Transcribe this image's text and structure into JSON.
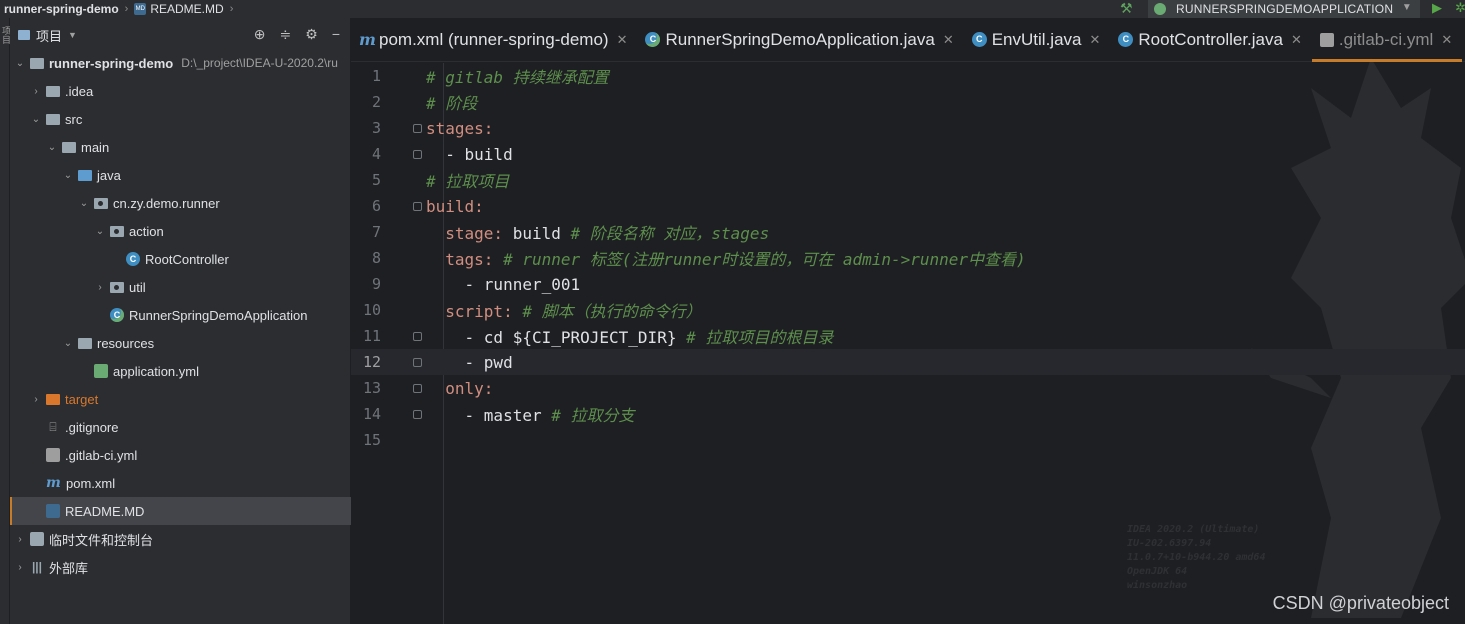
{
  "topbar": {
    "project": "runner-spring-demo",
    "file": "README.MD",
    "run_config": "RUNNERSPRINGDEMOAPPLICATION"
  },
  "toolstrip": {
    "label": "项目"
  },
  "project_panel": {
    "title": "项目",
    "root_name": "runner-spring-demo",
    "root_path": "D:\\_project\\IDEA-U-2020.2\\ru",
    "items": {
      "idea": ".idea",
      "src": "src",
      "main": "main",
      "java": "java",
      "pkg": "cn.zy.demo.runner",
      "action": "action",
      "rootcontroller": "RootController",
      "util": "util",
      "app": "RunnerSpringDemoApplication",
      "resources": "resources",
      "appyml": "application.yml",
      "target": "target",
      "gitignore": ".gitignore",
      "gitlabci": ".gitlab-ci.yml",
      "pom": "pom.xml",
      "readme": "README.MD",
      "scratches": "临时文件和控制台",
      "libraries": "外部库"
    }
  },
  "tabs": [
    {
      "label": "pom.xml (runner-spring-demo)",
      "icon": "maven-icon"
    },
    {
      "label": "RunnerSpringDemoApplication.java",
      "icon": "spring-class-icon"
    },
    {
      "label": "EnvUtil.java",
      "icon": "class-icon"
    },
    {
      "label": "RootController.java",
      "icon": "class-icon"
    },
    {
      "label": ".gitlab-ci.yml",
      "icon": "yaml-icon",
      "active": true
    }
  ],
  "code": {
    "l1": "# gitlab 持续继承配置",
    "l2": "# 阶段",
    "l3": "stages:",
    "l4": "  - build",
    "l5": "# 拉取项目",
    "l6": "build:",
    "l7a": "  stage:",
    "l7b": " build ",
    "l7c": "# 阶段名称 对应，stages",
    "l8a": "  tags:",
    "l8b": " # runner 标签(注册runner时设置的，可在 admin->runner中查看)",
    "l9": "    - runner_001",
    "l10a": "  script:",
    "l10b": " # 脚本（执行的命令行）",
    "l11a": "    - cd ${CI_PROJECT_DIR} ",
    "l11b": "# 拉取项目的根目录",
    "l12": "    - pwd",
    "l13": "  only:",
    "l14a": "    - master ",
    "l14b": "# 拉取分支",
    "line_numbers": [
      "1",
      "2",
      "3",
      "4",
      "5",
      "6",
      "7",
      "8",
      "9",
      "10",
      "11",
      "12",
      "13",
      "14",
      "15"
    ]
  },
  "watermark": {
    "l1": "IDEA 2020.2 (Ultimate)",
    "l2": "IU-202.6397.94",
    "l3": "11.0.7+10-b944.20 amd64",
    "l4": "OpenJDK 64",
    "l5": "winsonzhao"
  },
  "csdn": "CSDN @privateobject"
}
